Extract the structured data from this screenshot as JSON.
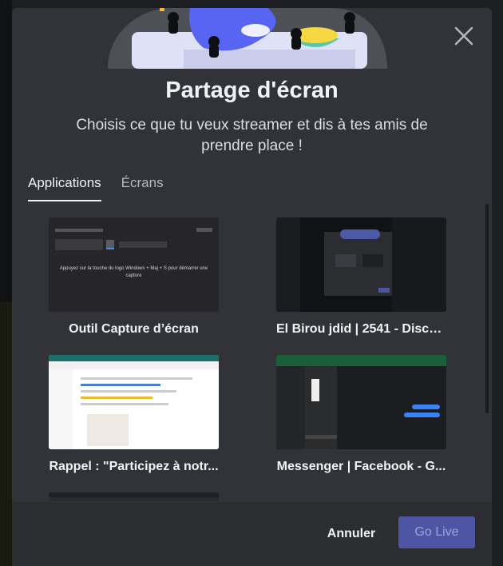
{
  "modal": {
    "title": "Partage d'écran",
    "subtitle": "Choisis ce que tu veux streamer et dis à tes amis de prendre place !"
  },
  "tabs": [
    {
      "label": "Applications",
      "active": true
    },
    {
      "label": "Écrans",
      "active": false
    }
  ],
  "sources": [
    {
      "label": "Outil Capture d’écran",
      "preview_text": "Appuyez sur la touche du logo Windows + Maj + S pour démarrer une capture"
    },
    {
      "label": "El Birou jdid | 2541 - Disco..."
    },
    {
      "label": "Rappel : \"Participez à notr..."
    },
    {
      "label": "Messenger | Facebook - G..."
    }
  ],
  "footer": {
    "cancel_label": "Annuler",
    "go_live_label": "Go Live"
  },
  "colors": {
    "modal_bg": "#313338",
    "footer_bg": "#2b2d31",
    "accent": "#5865f2",
    "go_live_disabled": "#4e55a5"
  }
}
